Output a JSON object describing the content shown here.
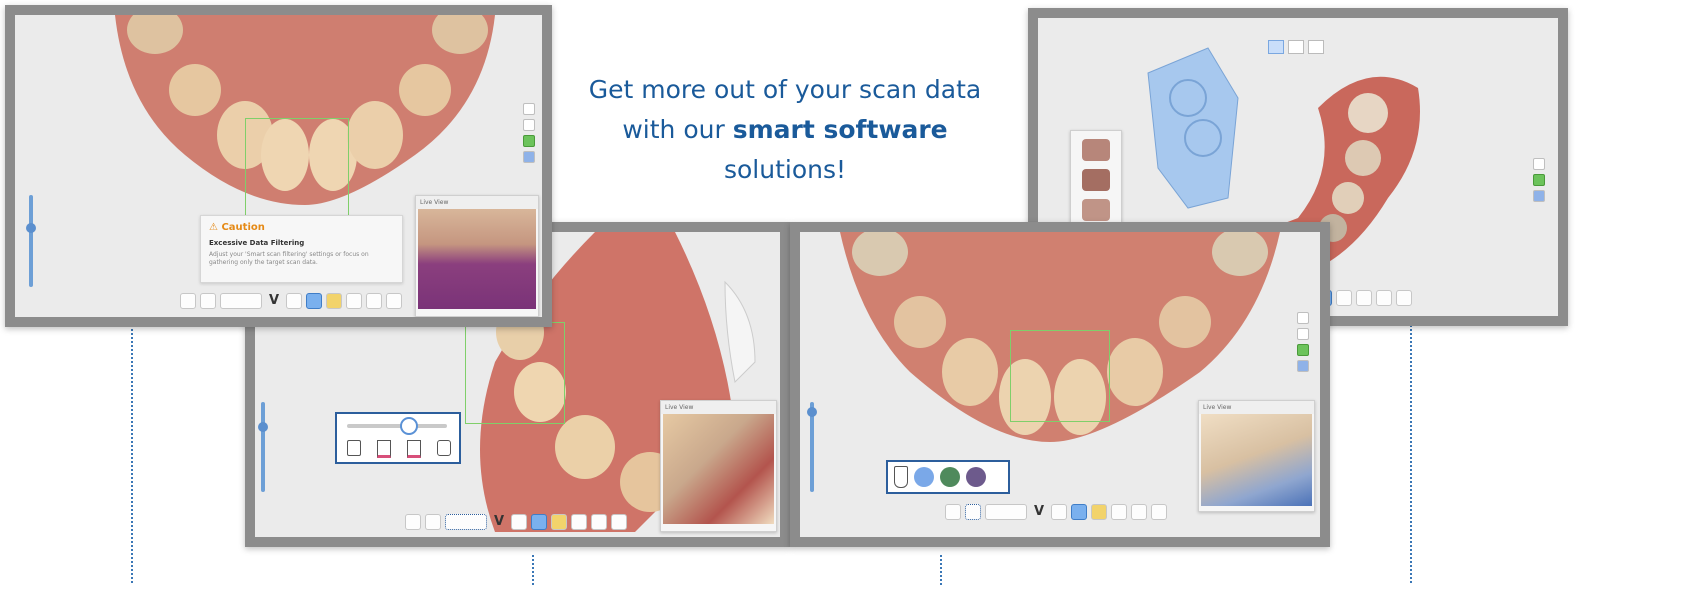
{
  "headline": {
    "line1": "Get more out of your scan data",
    "line2_prefix": "with our ",
    "line2_bold": "smart software",
    "line2_suffix": " solutions!"
  },
  "screens": {
    "top_left": {
      "warning_title": "Caution",
      "warning_subtitle": "Excessive Data Filtering",
      "warning_text": "Adjust your 'Smart scan filtering' settings or focus on gathering only the target scan data.",
      "popup_title": "Live View"
    },
    "bottom_left": {
      "popup_title": "Live View"
    },
    "bottom_right": {
      "popup_title": "Live View"
    },
    "top_right": {}
  },
  "colors": {
    "accent": "#1a5a9a",
    "frame": "#8c8c8c",
    "screen_bg": "#ebebeb",
    "warning": "#e58a16",
    "selection": "#7fcf6a"
  }
}
